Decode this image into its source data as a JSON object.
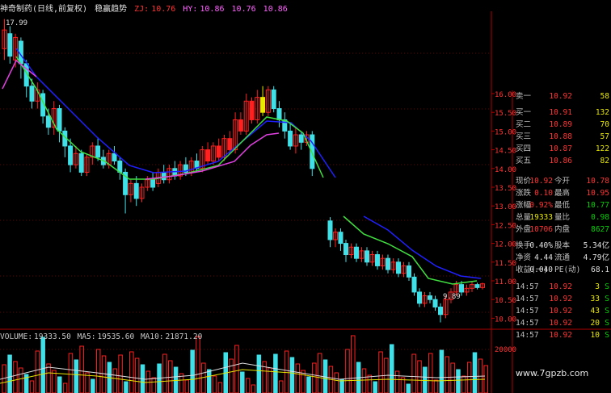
{
  "title_bar": {
    "stock": "神奇制药(日线,前复权)",
    "indicator": "稳赢趋势",
    "zj_label": "ZJ:",
    "zj_value": "10.76",
    "hy_label": "HY:",
    "hy_value": "10.86",
    "v3": "10.76",
    "v4": "10.86"
  },
  "price_axis": [
    "16.00",
    "15.50",
    "15.00",
    "14.50",
    "14.00",
    "13.50",
    "13.00",
    "12.50",
    "12.00",
    "11.50",
    "11.00",
    "10.50",
    "10.00"
  ],
  "markers": {
    "high_label": "17.99",
    "low_label": "9.89"
  },
  "volume_bar": {
    "label": "VOLUME:",
    "volume": "19333.50",
    "ma5_label": "MA5:",
    "ma5": "19535.60",
    "ma10_label": "MA10:",
    "ma10": "21871.20"
  },
  "volume_axis": "20000",
  "order_book": [
    {
      "label": "卖一",
      "price": "10.92",
      "qty": "58"
    },
    {
      "label": "买一",
      "price": "10.91",
      "qty": "132"
    },
    {
      "label": "买二",
      "price": "10.89",
      "qty": "70"
    },
    {
      "label": "买三",
      "price": "10.88",
      "qty": "57"
    },
    {
      "label": "买四",
      "price": "10.87",
      "qty": "122"
    },
    {
      "label": "买五",
      "price": "10.86",
      "qty": "82"
    }
  ],
  "stats": [
    {
      "l1": "现价",
      "v1": "10.92",
      "l2": "今开",
      "v2": "10.78"
    },
    {
      "l1": "涨跌",
      "v1": "0.10",
      "l2": "最高",
      "v2": "10.95"
    },
    {
      "l1": "涨幅",
      "v1": "0.92%",
      "l2": "最低",
      "v2": "10.77"
    },
    {
      "l1": "总量",
      "v1": "19333",
      "l2": "量比",
      "v2": "0.98"
    },
    {
      "l1": "外盘",
      "v1": "10706",
      "l2": "内盘",
      "v2": "8627"
    },
    {
      "l1": "换手",
      "v1": "0.40%",
      "l2": "股本",
      "v2": "5.34亿"
    },
    {
      "l1": "净资",
      "v1": "4.44",
      "l2": "流通",
      "v2": "4.79亿"
    },
    {
      "l1": "收益(一)",
      "v1": "0.040",
      "l2": "PE(动)",
      "v2": "68.1"
    }
  ],
  "ticks": [
    {
      "time": "14:57",
      "price": "10.92",
      "vol": "3",
      "side": "S"
    },
    {
      "time": "14:57",
      "price": "10.92",
      "vol": "33",
      "side": "S"
    },
    {
      "time": "14:57",
      "price": "10.92",
      "vol": "43",
      "side": "S"
    },
    {
      "time": "14:57",
      "price": "10.92",
      "vol": "20",
      "side": "S"
    },
    {
      "time": "14:57",
      "price": "10.92",
      "vol": "10",
      "side": "S"
    }
  ],
  "watermark": "www.7gpzb.com",
  "colors": {
    "up": "#ff2020",
    "down": "#40e0e8",
    "ma_blue": "#2020ff",
    "ma_green": "#40e040",
    "ma_magenta": "#e040e0",
    "yellow": "#e8e800"
  }
}
